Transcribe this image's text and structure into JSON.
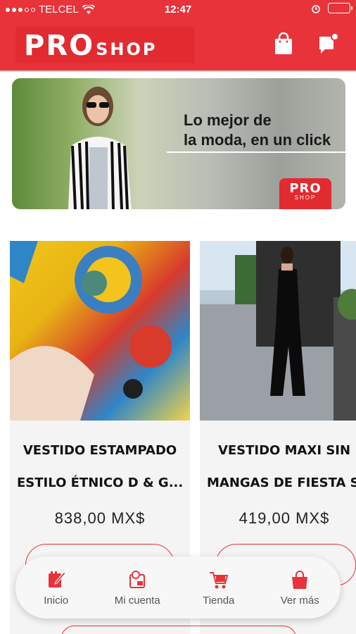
{
  "status_bar": {
    "carrier": "TELCEL",
    "time": "12:47"
  },
  "header": {
    "logo_pro": "PRO",
    "logo_shop": "SHOP",
    "icons": [
      "shopping-bag-icon",
      "chat-icon"
    ]
  },
  "banner": {
    "line1": "Lo mejor de",
    "line2": "la moda, en un click",
    "logo_pro": "PRO",
    "logo_shop": "SHOP"
  },
  "products": [
    {
      "title_line1": "VESTIDO ESTAMPADO",
      "title_line2": "ESTILO ÉTNICO D & G...",
      "price": "838,00 MX$"
    },
    {
      "title_line1": "VESTIDO MAXI SIN",
      "title_line2": "MANGAS DE FIESTA SE...",
      "price": "419,00 MX$"
    }
  ],
  "bottom_nav": {
    "items": [
      {
        "label": "Inicio",
        "icon": "notepad-icon"
      },
      {
        "label": "Mi cuenta",
        "icon": "account-icon"
      },
      {
        "label": "Tienda",
        "icon": "cart-icon"
      },
      {
        "label": "Ver más",
        "icon": "bag-icon"
      }
    ]
  },
  "colors": {
    "brand_red": "#e8333a",
    "card_bg": "#f4f4f4"
  }
}
